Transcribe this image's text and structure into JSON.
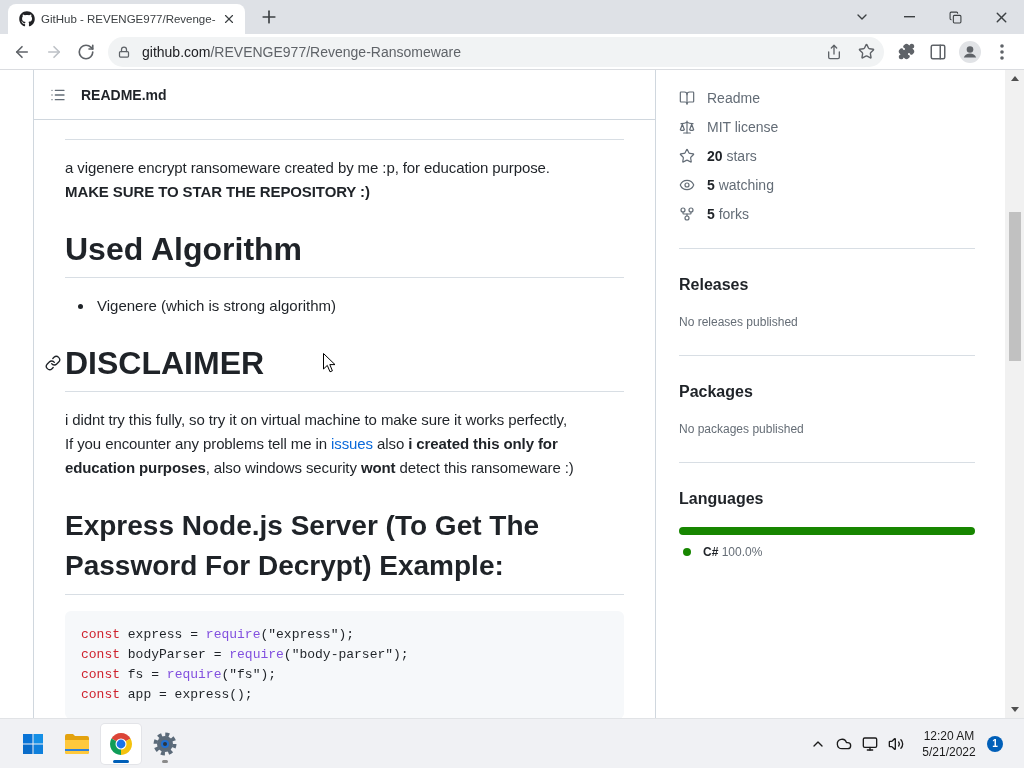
{
  "browser": {
    "tabs": [
      {
        "title": "GitHub - REVENGE977/Revenge-",
        "selected": true
      }
    ],
    "nav": [
      {
        "kind": "back",
        "disabled": false
      },
      {
        "kind": "forward",
        "disabled": true
      },
      {
        "kind": "reload",
        "disabled": false
      }
    ],
    "address": {
      "host": "github.com",
      "path": "/REVENGE977/Revenge-Ransomeware"
    }
  },
  "readme": {
    "file_name": "README.md",
    "blocks": [
      {
        "kind": "paragraph",
        "segments": [
          {
            "kind": "text",
            "text": "a vigenere encrypt ransomeware created by me :p, for education purpose."
          },
          {
            "kind": "break"
          },
          {
            "kind": "text",
            "text": "**MAKE SURE TO STAR THE REPOSITORY :)**"
          }
        ]
      },
      {
        "kind": "heading1",
        "text": "Used Algorithm",
        "anchor_visible": false
      },
      {
        "kind": "list",
        "items": [
          "Vigenere (which is strong algorithm)"
        ]
      },
      {
        "kind": "heading1",
        "text": "DISCLAIMER",
        "anchor_visible": true
      },
      {
        "kind": "paragraph",
        "segments": [
          {
            "kind": "text",
            "text": "i didnt try this fully, so try it on virtual machine to make sure it works perfectly,"
          },
          {
            "kind": "break"
          },
          {
            "kind": "text",
            "text": "If you encounter any problems tell me in "
          },
          {
            "kind": "link",
            "text": "issues"
          },
          {
            "kind": "text",
            "text": " also **i created this only for education purposes**, also windows security **wont** detect this ransomeware :)"
          }
        ]
      },
      {
        "kind": "heading2",
        "text": "Express Node.js Server (To Get The Password For Decrypt) Example:",
        "anchor_visible": false
      },
      {
        "kind": "code",
        "lines": [
          {
            "tokens": [
              {
                "kind": "keyword",
                "text": "const"
              },
              {
                "kind": "plain",
                "text": " express = "
              },
              {
                "kind": "function",
                "text": "require"
              },
              {
                "kind": "plain",
                "text": "(\"express\");"
              }
            ]
          },
          {
            "tokens": [
              {
                "kind": "keyword",
                "text": "const"
              },
              {
                "kind": "plain",
                "text": " bodyParser = "
              },
              {
                "kind": "function",
                "text": "require"
              },
              {
                "kind": "plain",
                "text": "(\"body-parser\");"
              }
            ]
          },
          {
            "tokens": [
              {
                "kind": "keyword",
                "text": "const"
              },
              {
                "kind": "plain",
                "text": " fs = "
              },
              {
                "kind": "function",
                "text": "require"
              },
              {
                "kind": "plain",
                "text": "(\"fs\");"
              }
            ]
          },
          {
            "tokens": [
              {
                "kind": "keyword",
                "text": "const"
              },
              {
                "kind": "plain",
                "text": " app = express();"
              }
            ]
          }
        ]
      }
    ]
  },
  "sidebar": {
    "about": [
      {
        "kind": "book",
        "text": "Readme"
      },
      {
        "kind": "scale",
        "text": "MIT license"
      },
      {
        "kind": "star",
        "text": "**20** stars"
      },
      {
        "kind": "eye",
        "text": "**5** watching"
      },
      {
        "kind": "fork",
        "text": "**5** forks"
      }
    ],
    "sections": [
      {
        "title": "Releases",
        "note": "No releases published"
      },
      {
        "title": "Packages",
        "note": "No packages published"
      }
    ],
    "languages": {
      "title": "Languages",
      "items": [
        {
          "name": "C#",
          "share": "100.0%",
          "color": "#178600",
          "level": 1
        }
      ]
    }
  },
  "taskbar": {
    "apps": [
      {
        "kind": "start",
        "selected": false,
        "running": false
      },
      {
        "kind": "files",
        "selected": false,
        "running": false
      },
      {
        "kind": "browser",
        "selected": true,
        "running": true
      },
      {
        "kind": "settings",
        "selected": false,
        "running": true
      }
    ],
    "time": "12:20 AM",
    "date": "5/21/2022",
    "notifications": "1"
  }
}
